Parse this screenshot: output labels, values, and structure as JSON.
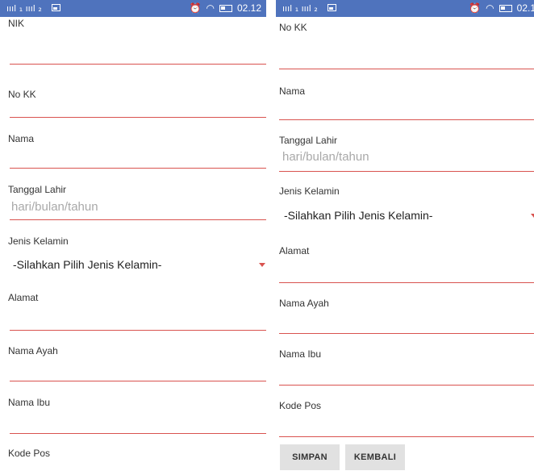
{
  "status_bar": {
    "signal": "ıııl ₁ ıııl ₂",
    "alarm_icon": "alarm-clock-icon",
    "wifi_icon": "wifi-icon",
    "battery_icon": "battery-icon",
    "time_left": "02.12",
    "time_right": "02.1"
  },
  "form": {
    "nik_label": "NIK",
    "nokk_label": "No KK",
    "nama_label": "Nama",
    "tanggal_lahir_label": "Tanggal Lahir",
    "tanggal_lahir_placeholder": "hari/bulan/tahun",
    "jenis_kelamin_label": "Jenis Kelamin",
    "jenis_kelamin_value": "-Silahkan Pilih Jenis Kelamin-",
    "alamat_label": "Alamat",
    "nama_ayah_label": "Nama Ayah",
    "nama_ibu_label": "Nama Ibu",
    "kode_pos_label": "Kode Pos"
  },
  "buttons": {
    "simpan": "SIMPAN",
    "kembali": "KEMBALI"
  },
  "colors": {
    "status_bar": "#4f73bd",
    "field_underline": "#d9534f",
    "button_bg": "#e1e1e1"
  }
}
